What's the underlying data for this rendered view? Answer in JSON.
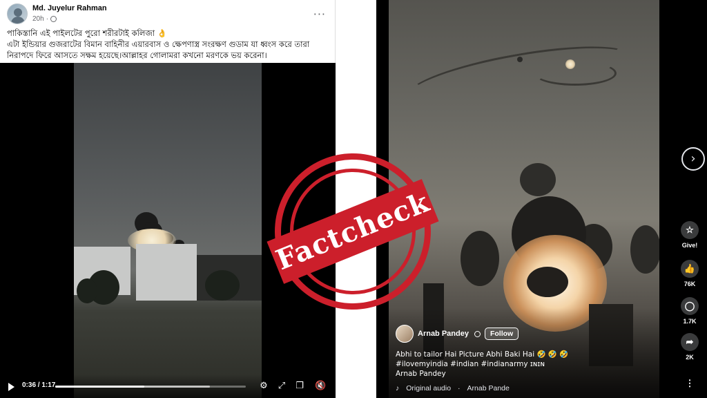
{
  "left_post": {
    "author": "Md. Juyelur Rahman",
    "time": "20h",
    "more_icon": "more-horizontal-icon",
    "text_lines": [
      "পাকিস্তানি এই পাইলটের পুরো শরীরটাই কলিজা 👌",
      "এটা ইন্ডিয়ার গুজরাটের বিমান বাহিনীর এয়ারবাস ও ক্ষেপণাস্ত্র সংরক্ষণ গুডাম যা ধ্বংস করে তারা",
      "নিরাপদে ফিরে আসতে সক্ষম হয়েছে।আল্লাহর গোলামরা কখনো মরণকে ভয় করেনা।"
    ],
    "video": {
      "time_display": "0:36 / 1:17",
      "progress_fraction": 0.468,
      "buffer_fraction": 0.81
    }
  },
  "stamp": {
    "text": "Factcheck",
    "color": "#cc1f2b"
  },
  "reel": {
    "author": "Arnab Pandey",
    "follow_label": "Follow",
    "caption_line1": "Abhi to tailor Hai Picture Abhi Baki Hai 🤣 🤣 🤣",
    "caption_line2": "#ilovemyindia #indian #indianarmy ɪɴɪɴ",
    "caption_line3": "Arnab Pandey",
    "audio_label": "Original audio",
    "audio_author": "Arnab Pande",
    "actions": [
      {
        "icon": "give-star-icon",
        "label": "Give!"
      },
      {
        "icon": "like-icon",
        "label": "76K"
      },
      {
        "icon": "comment-icon",
        "label": "1.7K"
      },
      {
        "icon": "share-icon",
        "label": "2K"
      },
      {
        "icon": "more-vertical-icon",
        "label": ""
      }
    ],
    "next_icon": "chevron-right-icon"
  }
}
